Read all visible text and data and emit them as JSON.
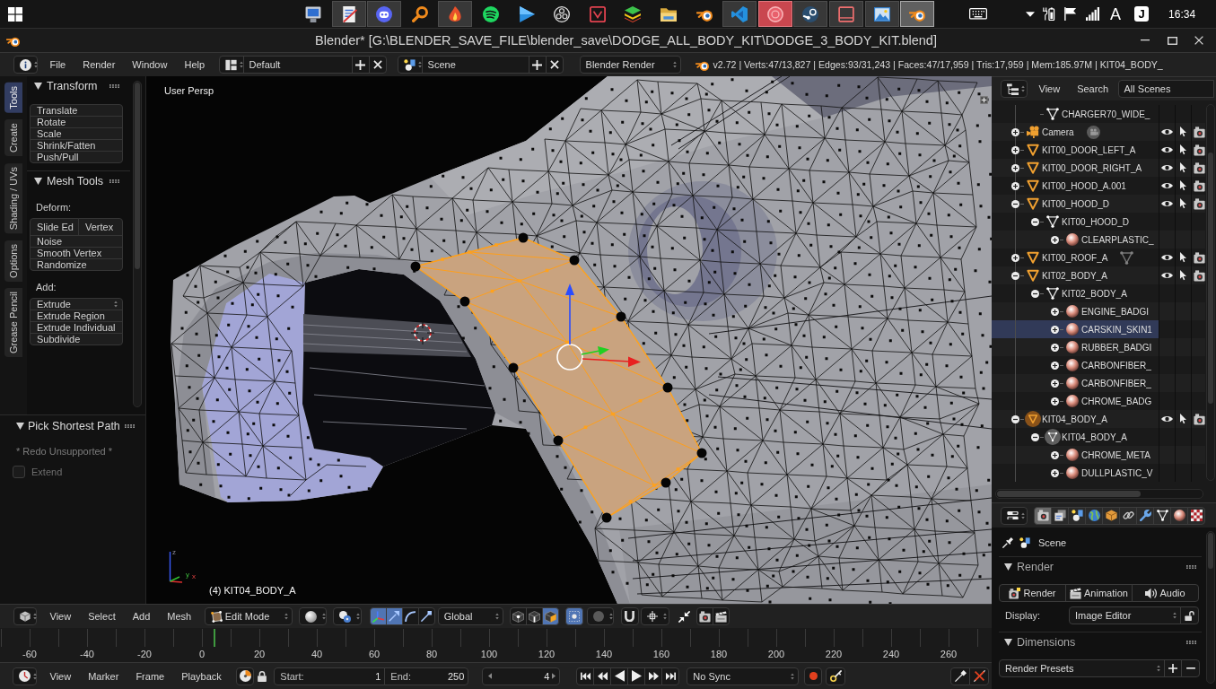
{
  "taskbar": {
    "apps": [
      {
        "kind": "monitor",
        "open": false,
        "selected": false,
        "alert": false
      },
      {
        "kind": "document",
        "open": true,
        "selected": false,
        "alert": false
      },
      {
        "kind": "chat",
        "open": true,
        "selected": false,
        "alert": false
      },
      {
        "kind": "magnifier",
        "open": false,
        "selected": false,
        "alert": false
      },
      {
        "kind": "flame",
        "open": true,
        "selected": false,
        "alert": false
      },
      {
        "kind": "music",
        "open": false,
        "selected": false,
        "alert": false
      },
      {
        "kind": "player",
        "open": false,
        "selected": false,
        "alert": false
      },
      {
        "kind": "aperture",
        "open": false,
        "selected": false,
        "alert": false
      },
      {
        "kind": "check_square",
        "open": false,
        "selected": false,
        "alert": false
      },
      {
        "kind": "layers",
        "open": false,
        "selected": false,
        "alert": false
      },
      {
        "kind": "folder",
        "open": false,
        "selected": false,
        "alert": false
      },
      {
        "kind": "orbit",
        "open": false,
        "selected": false,
        "alert": false
      },
      {
        "kind": "ribbon",
        "open": true,
        "selected": false,
        "alert": false
      },
      {
        "kind": "ring",
        "open": true,
        "selected": false,
        "alert": true
      },
      {
        "kind": "piston",
        "open": true,
        "selected": false,
        "alert": false
      },
      {
        "kind": "framed_square",
        "open": true,
        "selected": false,
        "alert": false
      },
      {
        "kind": "picture",
        "open": true,
        "selected": false,
        "alert": false
      },
      {
        "kind": "orbit",
        "open": true,
        "selected": true,
        "alert": false
      }
    ],
    "tray": {
      "input_mode": "A",
      "ime": "J",
      "clock": "16:34"
    }
  },
  "window": {
    "title": "Blender* [G:\\BLENDER_SAVE_FILE\\blender_save\\DODGE_ALL_BODY_KIT\\DODGE_3_BODY_KIT.blend]"
  },
  "info_header": {
    "menus": [
      "File",
      "Render",
      "Window",
      "Help"
    ],
    "layout": "Default",
    "scene": "Scene",
    "engine": "Blender Render",
    "stats": "v2.72 | Verts:47/13,827 | Edges:93/31,243 | Faces:47/17,959 | Tris:17,959 | Mem:185.97M | KIT04_BODY_"
  },
  "tool_shelf": {
    "tabs": [
      {
        "label": "Tools",
        "selected": true
      },
      {
        "label": "Create",
        "selected": false
      },
      {
        "label": "Shading / UVs",
        "selected": false
      },
      {
        "label": "Options",
        "selected": false
      },
      {
        "label": "Grease Pencil",
        "selected": false
      }
    ],
    "panels": [
      {
        "title": "Transform",
        "expanded": true,
        "sections": [
          {
            "items": [
              {
                "kind": "button",
                "label": "Translate"
              },
              {
                "kind": "button",
                "label": "Rotate"
              },
              {
                "kind": "button",
                "label": "Scale"
              },
              {
                "kind": "button",
                "label": "Shrink/Fatten"
              },
              {
                "kind": "button",
                "label": "Push/Pull"
              }
            ]
          }
        ]
      },
      {
        "title": "Mesh Tools",
        "expanded": true,
        "sections": [
          {
            "label": "Deform:",
            "items": [
              {
                "kind": "pair",
                "labels": [
                  "Slide Ed",
                  "Vertex"
                ]
              },
              {
                "kind": "button",
                "label": "Noise"
              },
              {
                "kind": "button",
                "label": "Smooth Vertex"
              },
              {
                "kind": "button",
                "label": "Randomize"
              }
            ]
          },
          {
            "label": "Add:",
            "items": [
              {
                "kind": "dropdown",
                "label": "Extrude"
              },
              {
                "kind": "button",
                "label": "Extrude Region"
              },
              {
                "kind": "button",
                "label": "Extrude Individual"
              },
              {
                "kind": "button",
                "label": "Subdivide"
              }
            ]
          }
        ]
      }
    ],
    "redo_panel": {
      "title": "Pick Shortest Path",
      "expanded": true,
      "message": "* Redo Unsupported *",
      "options": [
        {
          "label": "Extend",
          "checked": false,
          "disabled": true
        }
      ]
    }
  },
  "viewport": {
    "view_name": "User Persp",
    "object_label": "(4) KIT04_BODY_A",
    "axis_labels": [
      "z",
      "y",
      "x"
    ]
  },
  "viewport_header": {
    "menus": [
      "View",
      "Select",
      "Add",
      "Mesh"
    ],
    "mode": "Edit Mode",
    "manipulator": {
      "enabled": true,
      "modes": [
        {
          "kind": "translate",
          "selected": true
        },
        {
          "kind": "rotate",
          "selected": false
        },
        {
          "kind": "scale",
          "selected": false
        }
      ]
    },
    "orientation": "Global",
    "select_modes": [
      {
        "kind": "vertex",
        "selected": false
      },
      {
        "kind": "edge",
        "selected": false
      },
      {
        "kind": "face",
        "selected": true
      }
    ],
    "occlude_geometry": true
  },
  "timeline": {
    "frames": [
      "-60",
      "-40",
      "-20",
      "0",
      "20",
      "40",
      "60",
      "80",
      "100",
      "120",
      "140",
      "160",
      "180",
      "200",
      "220",
      "240",
      "260"
    ],
    "playhead": {
      "level": 0.216
    }
  },
  "timeline_header": {
    "menus": [
      "View",
      "Marker",
      "Frame",
      "Playback"
    ],
    "start_label": "Start:",
    "start": "1",
    "end_label": "End:",
    "end": "250",
    "current_frame": "4",
    "sync": "No Sync"
  },
  "outliner": {
    "menus": [
      "View",
      "Search"
    ],
    "filter": "All Scenes",
    "items": [
      {
        "kind": "mesh_data",
        "name": "CHARGER70_WIDE_",
        "selected": false,
        "active": false
      },
      {
        "kind": "camera",
        "name": "Camera",
        "expanded": false,
        "selected": false,
        "active": false,
        "preview": {
          "kind": "camera_data"
        }
      },
      {
        "kind": "mesh",
        "name": "KIT00_DOOR_LEFT_A",
        "expanded": false,
        "selected": false,
        "active": false
      },
      {
        "kind": "mesh",
        "name": "KIT00_DOOR_RIGHT_A",
        "expanded": false,
        "selected": false,
        "active": false
      },
      {
        "kind": "mesh",
        "name": "KIT00_HOOD_A.001",
        "expanded": false,
        "selected": false,
        "active": false
      },
      {
        "kind": "mesh",
        "name": "KIT00_HOOD_D",
        "expanded": true,
        "selected": false,
        "active": false,
        "children": [
          {
            "kind": "mesh_data",
            "name": "KIT00_HOOD_D",
            "expanded": true,
            "selected": false,
            "active": false,
            "children": [
              {
                "kind": "material",
                "name": "CLEARPLASTIC_",
                "expanded": false,
                "selected": false,
                "active": false
              }
            ]
          }
        ]
      },
      {
        "kind": "mesh",
        "name": "KIT00_ROOF_A",
        "expanded": false,
        "selected": false,
        "active": false,
        "preview": {
          "kind": "mesh_data"
        }
      },
      {
        "kind": "mesh",
        "name": "KIT02_BODY_A",
        "expanded": true,
        "selected": false,
        "active": false,
        "children": [
          {
            "kind": "mesh_data",
            "name": "KIT02_BODY_A",
            "expanded": true,
            "selected": false,
            "active": false,
            "children": [
              {
                "kind": "material",
                "name": "ENGINE_BADGI",
                "expanded": false,
                "selected": false,
                "active": false
              },
              {
                "kind": "material",
                "name": "CARSKIN_SKIN1",
                "expanded": false,
                "selected": true,
                "active": false
              },
              {
                "kind": "material",
                "name": "RUBBER_BADGI",
                "expanded": false,
                "selected": false,
                "active": false
              },
              {
                "kind": "material",
                "name": "CARBONFIBER_",
                "expanded": false,
                "selected": false,
                "active": false
              },
              {
                "kind": "material",
                "name": "CARBONFIBER_",
                "expanded": false,
                "selected": false,
                "active": false
              },
              {
                "kind": "material",
                "name": "CHROME_BADG",
                "expanded": false,
                "selected": false,
                "active": false
              }
            ]
          }
        ]
      },
      {
        "kind": "mesh",
        "name": "KIT04_BODY_A",
        "expanded": true,
        "selected": false,
        "active": true,
        "children": [
          {
            "kind": "mesh_data",
            "name": "KIT04_BODY_A",
            "expanded": true,
            "selected": false,
            "active": true,
            "children": [
              {
                "kind": "material",
                "name": "CHROME_META",
                "expanded": false,
                "selected": false,
                "active": false
              },
              {
                "kind": "material",
                "name": "DULLPLASTIC_V",
                "expanded": false,
                "selected": false,
                "active": false
              }
            ]
          }
        ]
      }
    ]
  },
  "properties": {
    "tabs": [
      {
        "kind": "render",
        "selected": true
      },
      {
        "kind": "render_layers",
        "selected": false
      },
      {
        "kind": "scene",
        "selected": false
      },
      {
        "kind": "world",
        "selected": false
      },
      {
        "kind": "object",
        "selected": false
      },
      {
        "kind": "constraints",
        "selected": false
      },
      {
        "kind": "modifiers",
        "selected": false
      },
      {
        "kind": "data",
        "selected": false
      },
      {
        "kind": "material",
        "selected": false
      },
      {
        "kind": "texture",
        "selected": false
      }
    ],
    "context": "Scene",
    "render_panel": {
      "title": "Render",
      "expanded": true,
      "buttons": [
        {
          "kind": "still",
          "label": "Render"
        },
        {
          "kind": "animation",
          "label": "Animation"
        },
        {
          "kind": "audio",
          "label": "Audio"
        }
      ],
      "display_label": "Display:",
      "display": "Image Editor"
    },
    "dimensions_panel": {
      "title": "Dimensions",
      "expanded": true,
      "presets": "Render Presets"
    }
  }
}
